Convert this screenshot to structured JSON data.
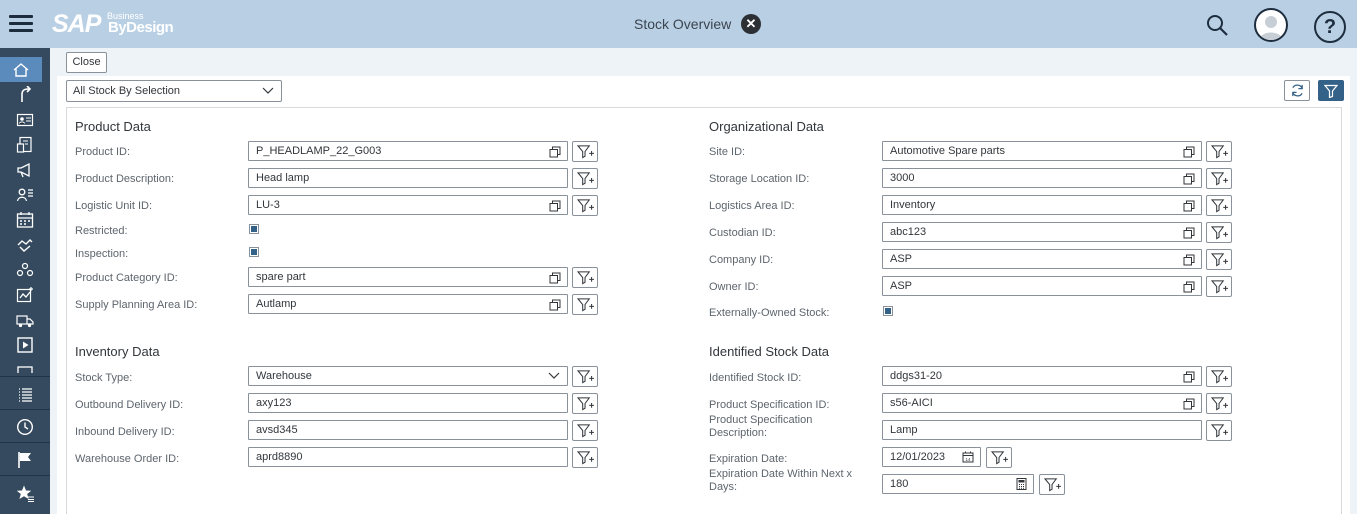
{
  "shell": {
    "brand_main": "SAP",
    "brand_sup": "Business",
    "brand_product": "ByDesign",
    "title": "Stock Overview"
  },
  "toolbar": {
    "close_label": "Close"
  },
  "view": {
    "selected": "All Stock By Selection"
  },
  "sections": {
    "product": {
      "title": "Product Data",
      "product_id": {
        "label": "Product ID:",
        "value": "P_HEADLAMP_22_G003"
      },
      "product_description": {
        "label": "Product Description:",
        "value": "Head lamp"
      },
      "logistic_unit_id": {
        "label": "Logistic Unit ID:",
        "value": "LU-3"
      },
      "restricted": {
        "label": "Restricted:",
        "checked": true
      },
      "inspection": {
        "label": "Inspection:",
        "checked": true
      },
      "product_category_id": {
        "label": "Product Category ID:",
        "value": "spare part"
      },
      "supply_planning_area_id": {
        "label": "Supply Planning Area ID:",
        "value": "Autlamp"
      }
    },
    "organizational": {
      "title": "Organizational Data",
      "site_id": {
        "label": "Site ID:",
        "value": "Automotive Spare parts"
      },
      "storage_location_id": {
        "label": "Storage Location ID:",
        "value": "3000"
      },
      "logistics_area_id": {
        "label": "Logistics Area ID:",
        "value": "Inventory"
      },
      "custodian_id": {
        "label": "Custodian ID:",
        "value": "abc123"
      },
      "company_id": {
        "label": "Company ID:",
        "value": "ASP"
      },
      "owner_id": {
        "label": "Owner ID:",
        "value": "ASP"
      },
      "externally_owned_stock": {
        "label": "Externally-Owned Stock:",
        "checked": true
      }
    },
    "inventory": {
      "title": "Inventory Data",
      "stock_type": {
        "label": "Stock Type:",
        "value": "Warehouse"
      },
      "outbound_delivery_id": {
        "label": "Outbound Delivery ID:",
        "value": "axy123"
      },
      "inbound_delivery_id": {
        "label": "Inbound Delivery ID:",
        "value": "avsd345"
      },
      "warehouse_order_id": {
        "label": "Warehouse Order ID:",
        "value": "aprd8890"
      }
    },
    "identified": {
      "title": "Identified Stock Data",
      "identified_stock_id": {
        "label": "Identified Stock ID:",
        "value": "ddgs31-20"
      },
      "product_specification_id": {
        "label": "Product Specification ID:",
        "value": "s56-AICI"
      },
      "product_specification_description": {
        "label_line1": "Product Specification",
        "label_line2": "Description:",
        "value": "Lamp"
      },
      "expiration_date": {
        "label": "Expiration Date:",
        "value": "12/01/2023"
      },
      "expiration_within_days": {
        "label_line1": "Expiration Date Within Next x",
        "label_line2": "Days:",
        "value": "180"
      }
    }
  },
  "icons": {
    "filter_add": "filter-add-icon",
    "value_help": "value-help-icon",
    "calendar": "calendar-icon",
    "calculator": "calculator-icon"
  },
  "colors": {
    "shell_bg": "#b9d0e4",
    "nav_bg": "#354a5f",
    "accent": "#346187"
  }
}
